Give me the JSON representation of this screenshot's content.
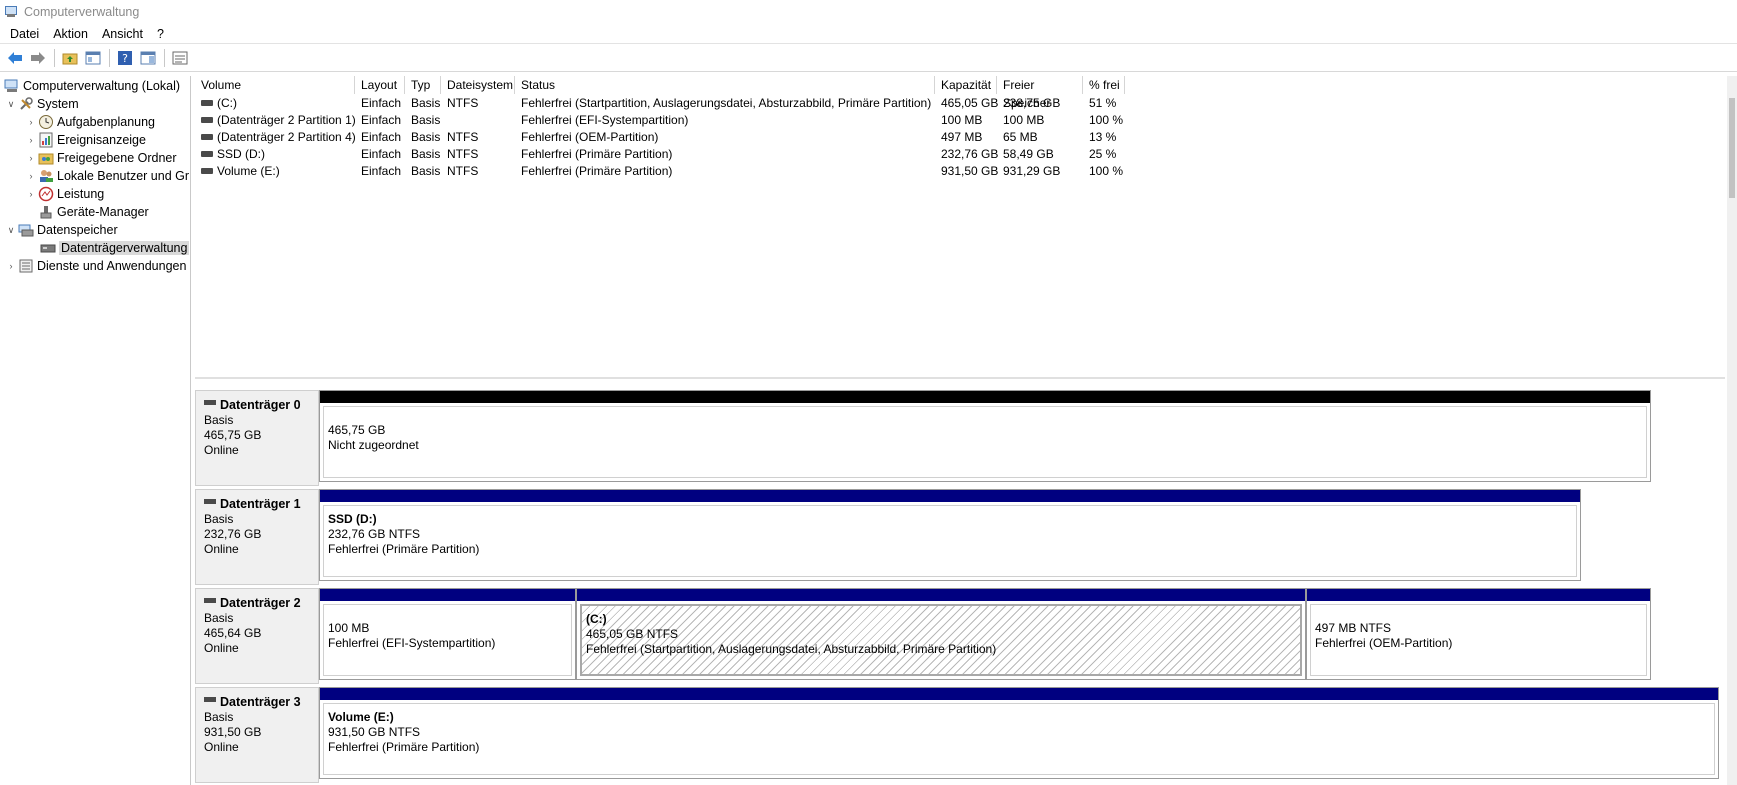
{
  "window": {
    "title": "Computerverwaltung"
  },
  "menu": [
    "Datei",
    "Aktion",
    "Ansicht",
    "?"
  ],
  "tree": {
    "root": "Computerverwaltung (Lokal)",
    "system": "System",
    "items": [
      "Aufgabenplanung",
      "Ereignisanzeige",
      "Freigegebene Ordner",
      "Lokale Benutzer und Gr",
      "Leistung",
      "Geräte-Manager"
    ],
    "storage": "Datenspeicher",
    "disk_mgmt": "Datenträgerverwaltung",
    "services": "Dienste und Anwendungen"
  },
  "columns": [
    "Volume",
    "Layout",
    "Typ",
    "Dateisystem",
    "Status",
    "Kapazität",
    "Freier Speicher",
    "% frei"
  ],
  "volumes": [
    [
      "(C:)",
      "Einfach",
      "Basis",
      "NTFS",
      "Fehlerfrei (Startpartition, Auslagerungsdatei, Absturzabbild, Primäre Partition)",
      "465,05 GB",
      "238,75 GB",
      "51 %"
    ],
    [
      "(Datenträger 2 Partition 1)",
      "Einfach",
      "Basis",
      "",
      "Fehlerfrei (EFI-Systempartition)",
      "100 MB",
      "100 MB",
      "100 %"
    ],
    [
      "(Datenträger 2 Partition 4)",
      "Einfach",
      "Basis",
      "NTFS",
      "Fehlerfrei (OEM-Partition)",
      "497 MB",
      "65 MB",
      "13 %"
    ],
    [
      "SSD (D:)",
      "Einfach",
      "Basis",
      "NTFS",
      "Fehlerfrei (Primäre Partition)",
      "232,76 GB",
      "58,49 GB",
      "25 %"
    ],
    [
      "Volume (E:)",
      "Einfach",
      "Basis",
      "NTFS",
      "Fehlerfrei (Primäre Partition)",
      "931,50 GB",
      "931,29 GB",
      "100 %"
    ]
  ],
  "disks": [
    {
      "name": "Datenträger 0",
      "type": "Basis",
      "size": "465,75 GB",
      "state": "Online",
      "partitions": [
        {
          "title": "",
          "line1": "465,75 GB",
          "line2": "Nicht zugeordnet",
          "color": "#000000"
        }
      ]
    },
    {
      "name": "Datenträger 1",
      "type": "Basis",
      "size": "232,76 GB",
      "state": "Online",
      "partitions": [
        {
          "title": "SSD  (D:)",
          "line1": "232,76 GB NTFS",
          "line2": "Fehlerfrei (Primäre Partition)",
          "color": "#000080"
        }
      ]
    },
    {
      "name": "Datenträger 2",
      "type": "Basis",
      "size": "465,64 GB",
      "state": "Online",
      "partitions": [
        {
          "title": "",
          "line1": "100 MB",
          "line2": "Fehlerfrei (EFI-Systempartition)",
          "color": "#000080"
        },
        {
          "title": "(C:)",
          "line1": "465,05 GB NTFS",
          "line2": "Fehlerfrei (Startpartition, Auslagerungsdatei, Absturzabbild, Primäre Partition)",
          "color": "#000080"
        },
        {
          "title": "",
          "line1": "497 MB NTFS",
          "line2": "Fehlerfrei (OEM-Partition)",
          "color": "#000080"
        }
      ]
    },
    {
      "name": "Datenträger 3",
      "type": "Basis",
      "size": "931,50 GB",
      "state": "Online",
      "partitions": [
        {
          "title": "Volume  (E:)",
          "line1": "931,50 GB NTFS",
          "line2": "Fehlerfrei (Primäre Partition)",
          "color": "#000080"
        }
      ]
    }
  ]
}
